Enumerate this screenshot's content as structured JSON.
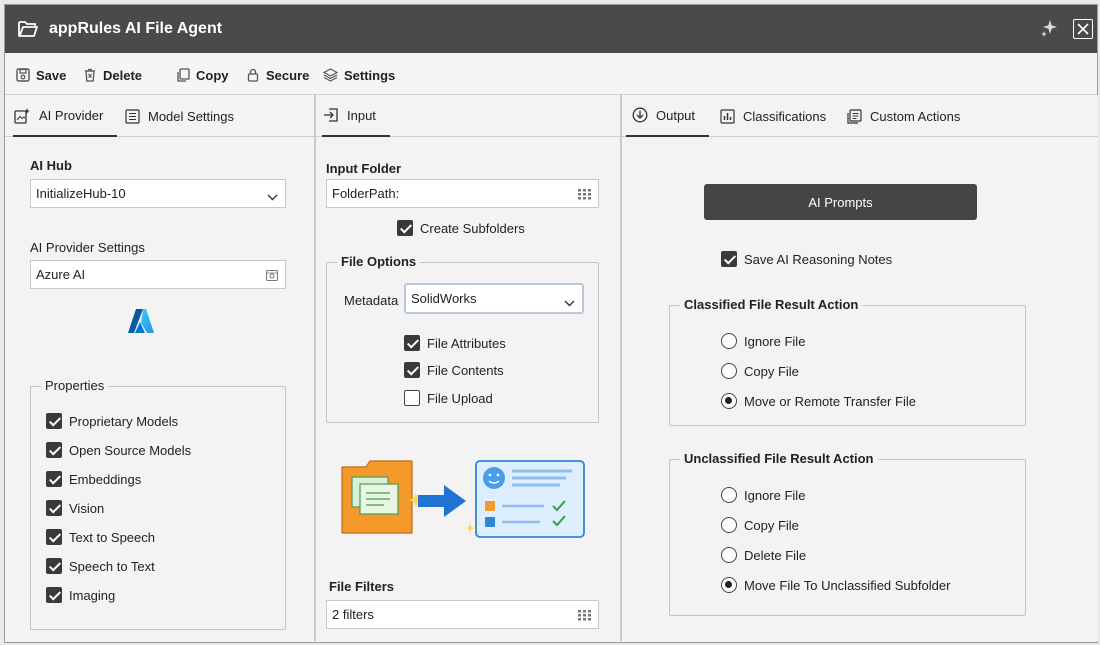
{
  "title": {
    "text": "appRules AI File Agent"
  },
  "toolbar": {
    "save": "Save",
    "delete": "Delete",
    "copy": "Copy",
    "secure": "Secure",
    "settings": "Settings"
  },
  "left_panel": {
    "tabs": [
      "AI Provider",
      "Model Settings"
    ],
    "ai_hub_label": "AI Hub",
    "ai_hub_value": "InitializeHub-10",
    "provider_settings_label": "AI Provider Settings",
    "provider_value": "Azure AI",
    "properties_label": "Properties",
    "properties": [
      {
        "label": "Proprietary Models",
        "checked": true
      },
      {
        "label": "Open Source Models",
        "checked": true
      },
      {
        "label": "Embeddings",
        "checked": true
      },
      {
        "label": "Vision",
        "checked": true
      },
      {
        "label": "Text to Speech",
        "checked": true
      },
      {
        "label": "Speech to Text",
        "checked": true
      },
      {
        "label": "Imaging",
        "checked": true
      }
    ]
  },
  "middle_panel": {
    "tabs": [
      "Input"
    ],
    "input_folder_label": "Input Folder",
    "input_folder_value": "FolderPath:",
    "create_subfolders": {
      "label": "Create Subfolders",
      "checked": true
    },
    "file_options_label": "File Options",
    "metadata_label": "Metadata",
    "metadata_value": "SolidWorks",
    "options": [
      {
        "label": "File Attributes",
        "checked": true
      },
      {
        "label": "File Contents",
        "checked": true
      },
      {
        "label": "File Upload",
        "checked": false
      }
    ],
    "file_filters_label": "File Filters",
    "file_filters_value": "2 filters"
  },
  "right_panel": {
    "tabs": [
      "Output",
      "Classifications",
      "Custom Actions"
    ],
    "ai_prompts_button": "AI Prompts",
    "save_reasoning": {
      "label": "Save AI Reasoning Notes",
      "checked": true
    },
    "classified_label": "Classified File Result Action",
    "classified_options": [
      {
        "label": "Ignore File",
        "selected": false
      },
      {
        "label": "Copy File",
        "selected": false
      },
      {
        "label": "Move or Remote Transfer File",
        "selected": true
      }
    ],
    "unclassified_label": "Unclassified File Result Action",
    "unclassified_options": [
      {
        "label": "Ignore File",
        "selected": false
      },
      {
        "label": "Copy File",
        "selected": false
      },
      {
        "label": "Delete File",
        "selected": false
      },
      {
        "label": "Move File To Unclassified Subfolder",
        "selected": true
      }
    ]
  }
}
